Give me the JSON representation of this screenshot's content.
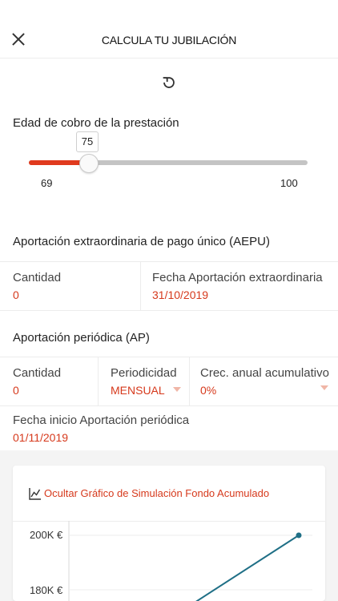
{
  "header": {
    "title": "CALCULA TU JUBILACIÓN"
  },
  "icons": {
    "close": "close-icon",
    "reset": "refresh-icon",
    "chart": "line-chart-icon"
  },
  "retirement_age": {
    "label": "Edad de cobro de la prestación",
    "value": "75",
    "min": "69",
    "max": "100",
    "fraction": 0.19
  },
  "aepu": {
    "title": "Aportación extraordinaria de pago único (AEPU)",
    "amount_label": "Cantidad",
    "amount_value": "0",
    "date_label": "Fecha Aportación extraordinaria",
    "date_value": "31/10/2019"
  },
  "ap": {
    "title": "Aportación periódica (AP)",
    "amount_label": "Cantidad",
    "amount_value": "0",
    "periodicity_label": "Periodicidad",
    "periodicity_value": "MENSUAL",
    "growth_label": "Crec. anual acumulativo",
    "growth_value": "0%",
    "start_date_label": "Fecha inicio Aportación periódica",
    "start_date_value": "01/11/2019"
  },
  "chart_toggle": {
    "label": "Ocultar Gráfico de Simulación Fondo Acumulado"
  },
  "colors": {
    "accent": "#d6391c",
    "slider_fill": "#e03a1e",
    "chart_line": "#1f6f86"
  },
  "chart_data": {
    "type": "line",
    "title": "",
    "xlabel": "",
    "ylabel": "",
    "ytick_labels": [
      "200K €",
      "180K €"
    ],
    "series": [
      {
        "values": [
          170000,
          200000
        ]
      }
    ]
  }
}
